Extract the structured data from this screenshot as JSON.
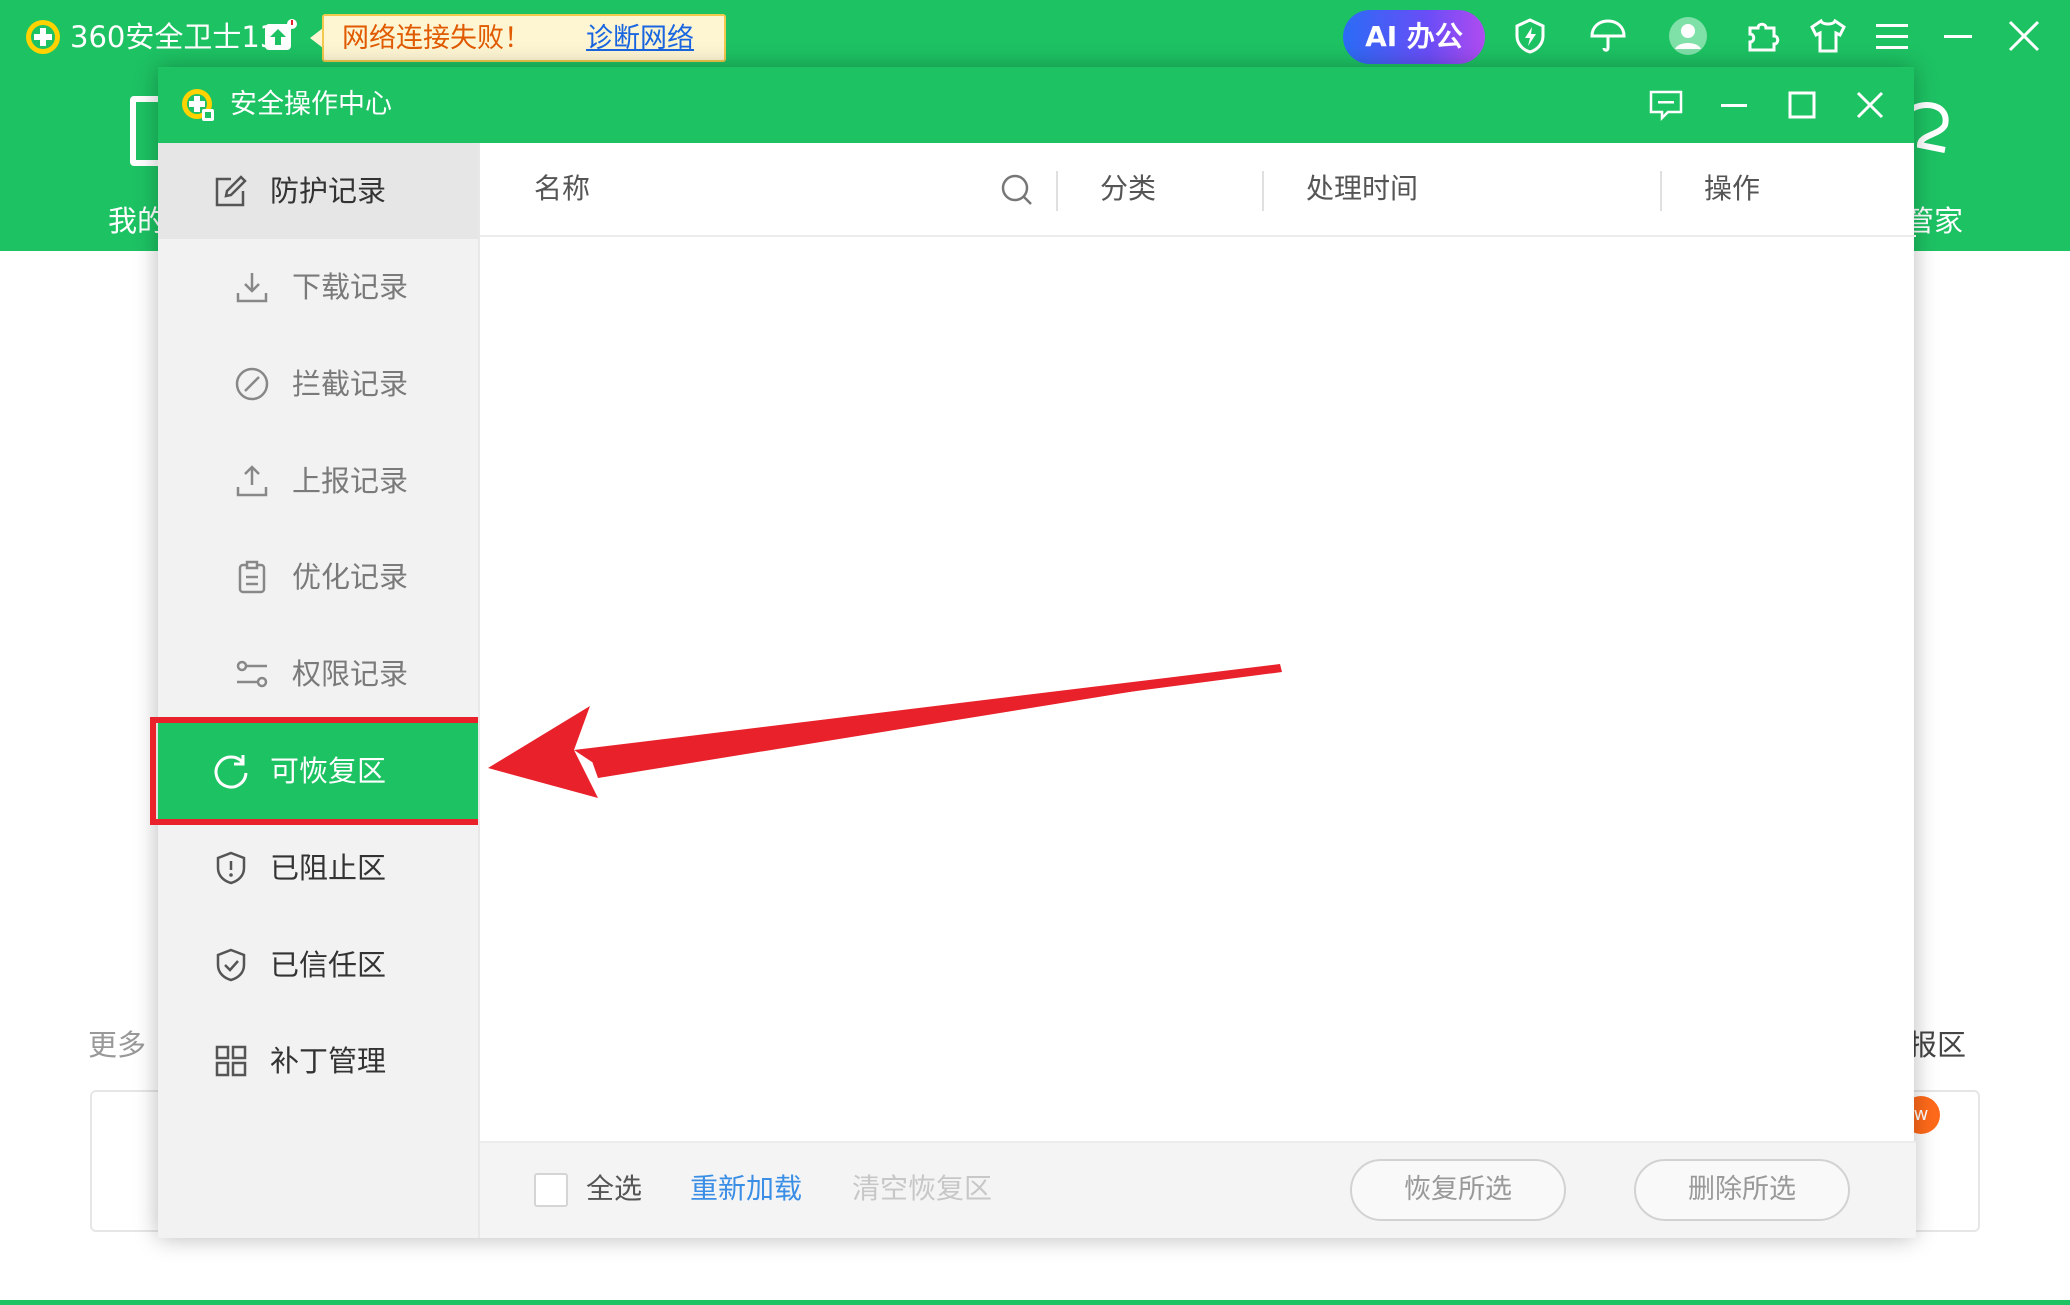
{
  "main_window": {
    "title": "360安全卫士13",
    "network_alert": {
      "message": "网络连接失败！",
      "link": "诊断网络"
    },
    "ai_button": "AI 办公",
    "left_partial_label": "我的",
    "right_partial_label": "管家",
    "more_partial_label": "更多",
    "report_partial_label": "报区",
    "new_badge": "w"
  },
  "dialog": {
    "title": "安全操作中心",
    "sidebar": {
      "items": [
        {
          "label": "防护记录",
          "icon": "edit-icon"
        },
        {
          "label": "下载记录",
          "icon": "download-icon"
        },
        {
          "label": "拦截记录",
          "icon": "block-icon"
        },
        {
          "label": "上报记录",
          "icon": "upload-icon"
        },
        {
          "label": "优化记录",
          "icon": "clipboard-icon"
        },
        {
          "label": "权限记录",
          "icon": "sliders-icon"
        },
        {
          "label": "可恢复区",
          "icon": "refresh-icon"
        },
        {
          "label": "已阻止区",
          "icon": "shield-alert-icon"
        },
        {
          "label": "已信任区",
          "icon": "shield-check-icon"
        },
        {
          "label": "补丁管理",
          "icon": "grid-icon"
        }
      ],
      "selected": "可恢复区"
    },
    "table": {
      "columns": [
        "名称",
        "分类",
        "处理时间",
        "操作"
      ],
      "rows": []
    },
    "footer": {
      "select_all": "全选",
      "reload": "重新加载",
      "clear": "清空恢复区",
      "restore_selected": "恢复所选",
      "delete_selected": "删除所选"
    }
  },
  "colors": {
    "brand_green": "#1dc263",
    "highlight_red": "#e8212a",
    "link_blue": "#3a8ee6"
  }
}
